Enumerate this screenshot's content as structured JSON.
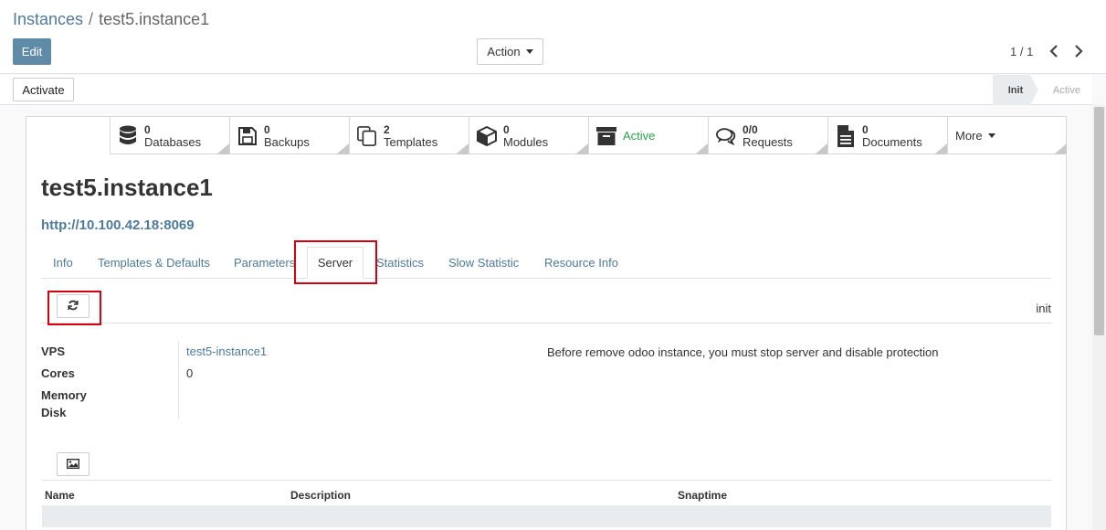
{
  "breadcrumb": {
    "parent": "Instances",
    "separator": "/",
    "current": "test5.instance1"
  },
  "control": {
    "edit_label": "Edit",
    "action_label": "Action",
    "pager": "1 / 1"
  },
  "statusbar": {
    "activate_label": "Activate",
    "stages": [
      "Init",
      "Active"
    ],
    "current_stage": "Init"
  },
  "smart_buttons": [
    {
      "count": "0",
      "label": "Databases",
      "icon": "database-icon"
    },
    {
      "count": "0",
      "label": "Backups",
      "icon": "floppy-disk-icon"
    },
    {
      "count": "2",
      "label": "Templates",
      "icon": "copy-icon"
    },
    {
      "count": "0",
      "label": "Modules",
      "icon": "cube-icon"
    },
    {
      "count": "",
      "label": "Active",
      "icon": "archive-icon"
    },
    {
      "count": "0/0",
      "label": "Requests",
      "icon": "comments-icon"
    },
    {
      "count": "0",
      "label": "Documents",
      "icon": "file-text-icon"
    },
    {
      "count": "",
      "label": "More",
      "icon": ""
    }
  ],
  "record": {
    "title": "test5.instance1",
    "url": "http://10.100.42.18:8069"
  },
  "tabs": [
    "Info",
    "Templates & Defaults",
    "Parameters",
    "Server",
    "Statistics",
    "Slow Statistic",
    "Resource Info"
  ],
  "active_tab": "Server",
  "server": {
    "state": "init",
    "fields": [
      {
        "label": "VPS",
        "value": "test5-instance1"
      },
      {
        "label": "Cores",
        "value": "0"
      },
      {
        "label": "Memory",
        "value": ""
      },
      {
        "label": "Disk",
        "value": ""
      }
    ],
    "note": "Before remove odoo instance, you must stop server and disable protection"
  },
  "snapshots_table": {
    "columns": [
      "Name",
      "Description",
      "Snaptime"
    ]
  },
  "colors": {
    "primary": "#5f8ba8",
    "link": "#4e7a9b",
    "active": "#28a745",
    "highlight": "#d9000d"
  }
}
